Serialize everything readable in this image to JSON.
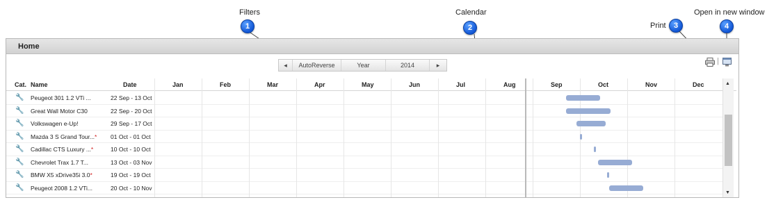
{
  "annotations": {
    "filters": {
      "label": "Filters",
      "number": "1"
    },
    "calendar": {
      "label": "Calendar",
      "number": "2"
    },
    "print": {
      "label": "Print",
      "number": "3"
    },
    "open_new_window": {
      "label": "Open in new window",
      "number": "4"
    }
  },
  "panel": {
    "title": "Home"
  },
  "filters": {
    "prev_arrow": "◂",
    "category": "AutoReverse",
    "period": "Year",
    "year": "2014",
    "next_arrow": "▸"
  },
  "toolbar": {
    "print_icon": "printer-icon",
    "separator": "|",
    "new_window_icon": "new-window-icon"
  },
  "grid": {
    "columns": {
      "cat": "Cat.",
      "name": "Name",
      "date": "Date"
    },
    "months": [
      "Jan",
      "Feb",
      "Mar",
      "Apr",
      "May",
      "Jun",
      "Jul",
      "Aug",
      "Sep",
      "Oct",
      "Nov",
      "Dec"
    ],
    "rows": [
      {
        "name": "Peugeot 301 1.2 VTi ...",
        "asterisk": "",
        "date": "22 Sep - 13 Oct",
        "start": "2014-09-22",
        "end": "2014-10-13"
      },
      {
        "name": "Great Wall Motor C30",
        "asterisk": "",
        "date": "22 Sep - 20 Oct",
        "start": "2014-09-22",
        "end": "2014-10-20"
      },
      {
        "name": "Volkswagen e-Up!",
        "asterisk": "",
        "date": "29 Sep - 17 Oct",
        "start": "2014-09-29",
        "end": "2014-10-17"
      },
      {
        "name": "Mazda 3 S Grand Tour...",
        "asterisk": "*",
        "date": "01 Oct - 01 Oct",
        "start": "2014-10-01",
        "end": "2014-10-01"
      },
      {
        "name": "Cadillac CTS Luxury ...",
        "asterisk": "*",
        "date": "10 Oct - 10 Oct",
        "start": "2014-10-10",
        "end": "2014-10-10"
      },
      {
        "name": "Chevrolet Trax 1.7 T...",
        "asterisk": "",
        "date": "13 Oct - 03 Nov",
        "start": "2014-10-13",
        "end": "2014-11-03"
      },
      {
        "name": "BMW X5 xDrive35i 3.0",
        "asterisk": "*",
        "date": "19 Oct - 19 Oct",
        "start": "2014-10-19",
        "end": "2014-10-19"
      },
      {
        "name": "Peugeot 2008 1.2 VTi...",
        "asterisk": "",
        "date": "20 Oct - 10 Nov",
        "start": "2014-10-20",
        "end": "2014-11-10"
      }
    ]
  },
  "colors": {
    "badge": "#1a66e0",
    "bar": "#97acd4"
  }
}
